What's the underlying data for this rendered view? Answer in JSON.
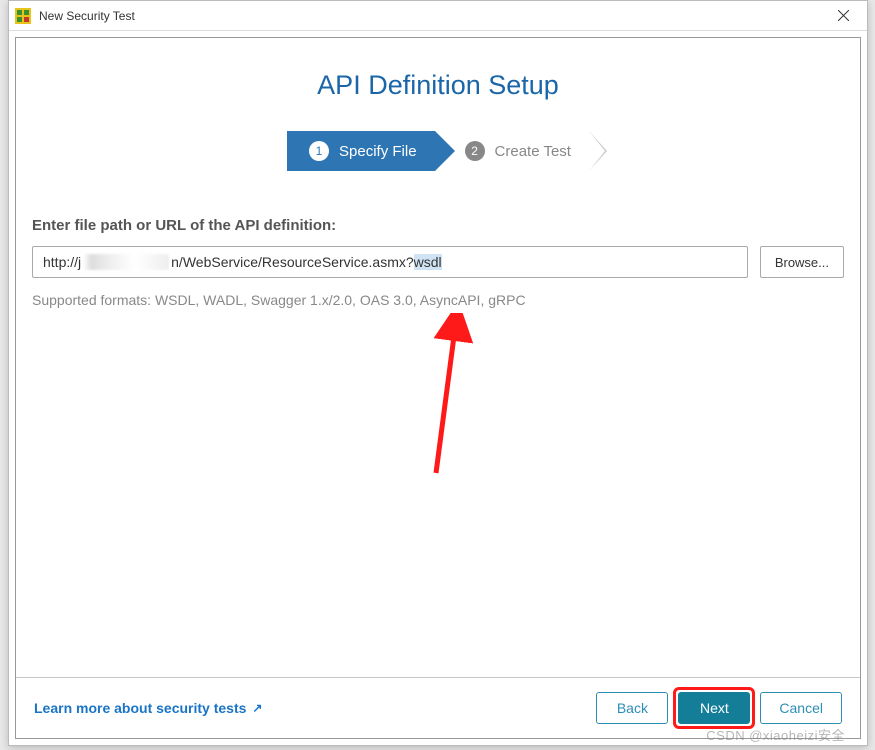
{
  "titlebar": {
    "title": "New Security Test"
  },
  "heading": "API Definition Setup",
  "wizard": {
    "step1": {
      "num": "1",
      "label": "Specify File"
    },
    "step2": {
      "num": "2",
      "label": "Create Test"
    }
  },
  "form": {
    "label": "Enter file path or URL of the API definition:",
    "value_prefix": "http://j",
    "value_mid": "n/WebService/ResourceService.asmx?",
    "value_selected": "wsdl",
    "browse_label": "Browse...",
    "supported": "Supported formats: WSDL, WADL, Swagger 1.x/2.0, OAS 3.0, AsyncAPI, gRPC"
  },
  "footer": {
    "learn_more": "Learn more about security tests",
    "back": "Back",
    "next": "Next",
    "cancel": "Cancel"
  },
  "watermark": "CSDN @xiaoheizi安全"
}
